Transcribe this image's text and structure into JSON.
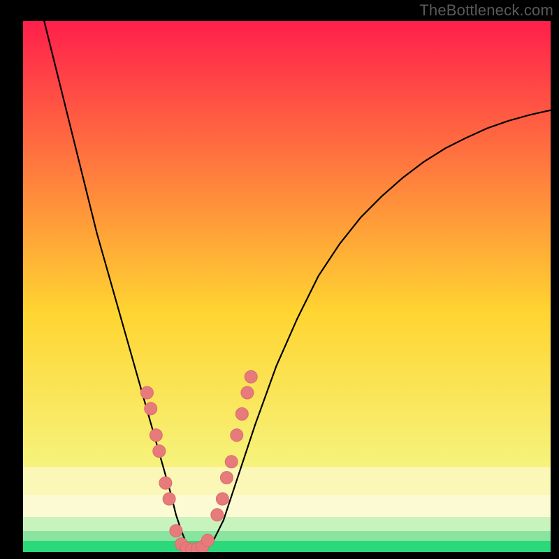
{
  "watermark": "TheBottleneck.com",
  "colors": {
    "frame": "#000000",
    "watermark_text": "#5a5a5a",
    "curve": "#000000",
    "dot_fill": "#e77a7a",
    "dot_stroke": "#d86e6e",
    "band_yellow_pale": "#fbf7b6",
    "band_yellow_pale2": "#fcfad2",
    "band_green_pale": "#c9f3bc",
    "band_green_mid": "#88e49e",
    "band_green_strong": "#2bd87a",
    "grad_top": "#ff1f4b",
    "grad_yellow": "#ffd531",
    "grad_bottom_near": "#f6f27a"
  },
  "chart_data": {
    "type": "line",
    "title": "",
    "xlabel": "",
    "ylabel": "",
    "xlim": [
      0,
      100
    ],
    "ylim": [
      0,
      100
    ],
    "grid": false,
    "legend_position": "none",
    "description": "V-shaped bottleneck curve over a vertical red-to-yellow-to-green gradient. Curve descends steeply from upper-left, reaches a flat minimum near x≈32 at y≈0, then rises with diminishing slope toward upper-right. Salmon-colored circular markers cluster along both descending and ascending arms near the bottom.",
    "series": [
      {
        "name": "curve",
        "x": [
          4,
          6,
          8,
          10,
          12,
          14,
          16,
          18,
          20,
          22,
          24,
          26,
          28,
          29,
          30,
          31,
          32,
          33,
          34,
          36,
          38,
          40,
          44,
          48,
          52,
          56,
          60,
          64,
          68,
          72,
          76,
          80,
          84,
          88,
          92,
          96,
          100
        ],
        "y": [
          100,
          92,
          84,
          76,
          68,
          60,
          53,
          46,
          39,
          32,
          25,
          18,
          11,
          7,
          4,
          1.5,
          0.5,
          0.3,
          0.5,
          2,
          6,
          12,
          24,
          35,
          44,
          52,
          58,
          63,
          67,
          70.5,
          73.5,
          76,
          78,
          79.8,
          81.2,
          82.3,
          83.2
        ]
      }
    ],
    "markers": {
      "name": "dots",
      "points": [
        {
          "x": 23.5,
          "y": 30
        },
        {
          "x": 24.2,
          "y": 27
        },
        {
          "x": 25.2,
          "y": 22
        },
        {
          "x": 25.8,
          "y": 19
        },
        {
          "x": 27.0,
          "y": 13
        },
        {
          "x": 27.7,
          "y": 10
        },
        {
          "x": 29.0,
          "y": 4
        },
        {
          "x": 30.0,
          "y": 1.5
        },
        {
          "x": 31.0,
          "y": 0.7
        },
        {
          "x": 32.0,
          "y": 0.5
        },
        {
          "x": 33.0,
          "y": 0.6
        },
        {
          "x": 34.0,
          "y": 1.0
        },
        {
          "x": 35.0,
          "y": 2.2
        },
        {
          "x": 36.8,
          "y": 7
        },
        {
          "x": 37.8,
          "y": 10
        },
        {
          "x": 38.6,
          "y": 14
        },
        {
          "x": 39.5,
          "y": 17
        },
        {
          "x": 40.5,
          "y": 22
        },
        {
          "x": 41.5,
          "y": 26
        },
        {
          "x": 42.5,
          "y": 30
        },
        {
          "x": 43.2,
          "y": 33
        }
      ]
    }
  }
}
